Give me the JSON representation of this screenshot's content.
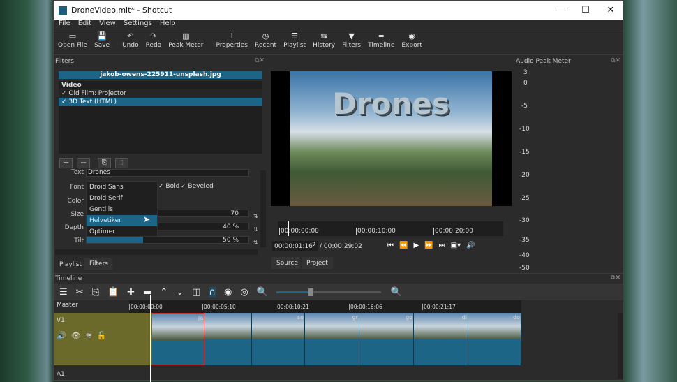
{
  "window": {
    "title": "DroneVideo.mlt* - Shotcut",
    "min": "—",
    "max": "☐",
    "close": "✕"
  },
  "menu": [
    "File",
    "Edit",
    "View",
    "Settings",
    "Help"
  ],
  "toolbar": [
    {
      "icon": "▭",
      "label": "Open File"
    },
    {
      "icon": "💾",
      "label": "Save"
    },
    {
      "icon": "↶",
      "label": "Undo"
    },
    {
      "icon": "↷",
      "label": "Redo"
    },
    {
      "icon": "▥",
      "label": "Peak Meter"
    },
    {
      "icon": "i",
      "label": "Properties"
    },
    {
      "icon": "◷",
      "label": "Recent"
    },
    {
      "icon": "☰",
      "label": "Playlist"
    },
    {
      "icon": "⇆",
      "label": "History"
    },
    {
      "icon": "▼",
      "label": "Filters"
    },
    {
      "icon": "≣",
      "label": "Timeline"
    },
    {
      "icon": "◉",
      "label": "Export"
    }
  ],
  "filters": {
    "title": "Filters",
    "file": "jakob-owens-225911-unsplash.jpg",
    "section": "Video",
    "items": [
      "✓  Old Film: Projector",
      "✓  3D Text (HTML)"
    ],
    "text_label": "Text",
    "text_value": "Drones",
    "font_label": "Font",
    "color_label": "Color",
    "size_label": "Size",
    "depth_label": "Depth",
    "tilt_label": "Tilt",
    "bold": "✓ Bold",
    "beveled": "✓ Beveled",
    "size_value": "70",
    "depth_value": "40 %",
    "tilt_value": "50 %",
    "tilt_fraction": 0.5,
    "font_options": [
      "Droid Sans",
      "Droid Serif",
      "Gentilis",
      "Helvetiker",
      "Optimer"
    ],
    "selected_font": "Helvetiker",
    "tabs": [
      "Playlist",
      "Filters"
    ]
  },
  "preview": {
    "overlay_text": "Drones",
    "ruler": [
      "00:00:00:00",
      "00:00:10:00",
      "00:00:20:00"
    ],
    "current": "00:00:01:16",
    "total": "/ 00:00:29:02",
    "tabs": [
      "Source",
      "Project"
    ]
  },
  "meter": {
    "title": "Audio Peak Meter",
    "scale": [
      "3",
      "0",
      "-5",
      "-10",
      "-15",
      "-20",
      "-25",
      "-30",
      "-35",
      "-40",
      "-50"
    ]
  },
  "timeline": {
    "title": "Timeline",
    "master": "Master",
    "v1": "V1",
    "a1": "A1",
    "ruler": [
      "00:00:00:00",
      "00:00:05:10",
      "00:00:10:21",
      "00:00:16:06",
      "00:00:21:17"
    ],
    "clips": [
      "ja",
      "",
      "so",
      "gr",
      "go",
      "di",
      "do"
    ]
  }
}
